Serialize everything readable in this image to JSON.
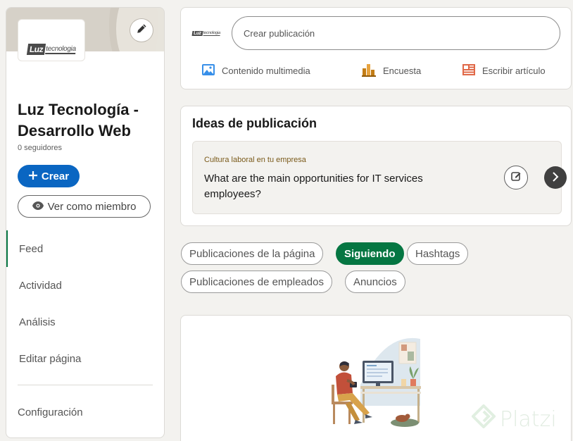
{
  "sidebar": {
    "logo": {
      "brand": "Luz",
      "brand_sub": "tecnologia"
    },
    "company_name": "Luz Tecnología - Desarrollo Web",
    "followers": "0 seguidores",
    "create_button": {
      "icon": "plus-icon",
      "label": "Crear"
    },
    "view_as_member_button": {
      "icon": "eye-icon",
      "label": "Ver como miembro"
    },
    "nav": [
      {
        "label": "Feed",
        "active": true
      },
      {
        "label": "Actividad",
        "active": false
      },
      {
        "label": "Análisis",
        "active": false
      },
      {
        "label": "Editar página",
        "active": false
      }
    ],
    "settings_label": "Configuración"
  },
  "create_post": {
    "placeholder": "Crear publicación",
    "actions": [
      {
        "icon": "image-icon",
        "label": "Contenido multimedia",
        "color": "#378fe9"
      },
      {
        "icon": "poll-icon",
        "label": "Encuesta",
        "color": "#c37d16"
      },
      {
        "icon": "article-icon",
        "label": "Escribir artículo",
        "color": "#e06847"
      }
    ]
  },
  "ideas": {
    "title": "Ideas de publicación",
    "tag": "Cultura laboral en tu empresa",
    "text": "What are the main opportunities for IT services employees?"
  },
  "filters": [
    {
      "label": "Publicaciones de la página",
      "selected": false
    },
    {
      "label": "Siguiendo",
      "selected": true
    },
    {
      "label": "Hashtags",
      "selected": false
    },
    {
      "label": "Publicaciones de empleados",
      "selected": false
    },
    {
      "label": "Anuncios",
      "selected": false
    }
  ],
  "watermark": {
    "text": "Platzi"
  },
  "colors": {
    "primary_blue": "#0a66c2",
    "accent_green": "#057642",
    "background": "#f3f2ef"
  }
}
